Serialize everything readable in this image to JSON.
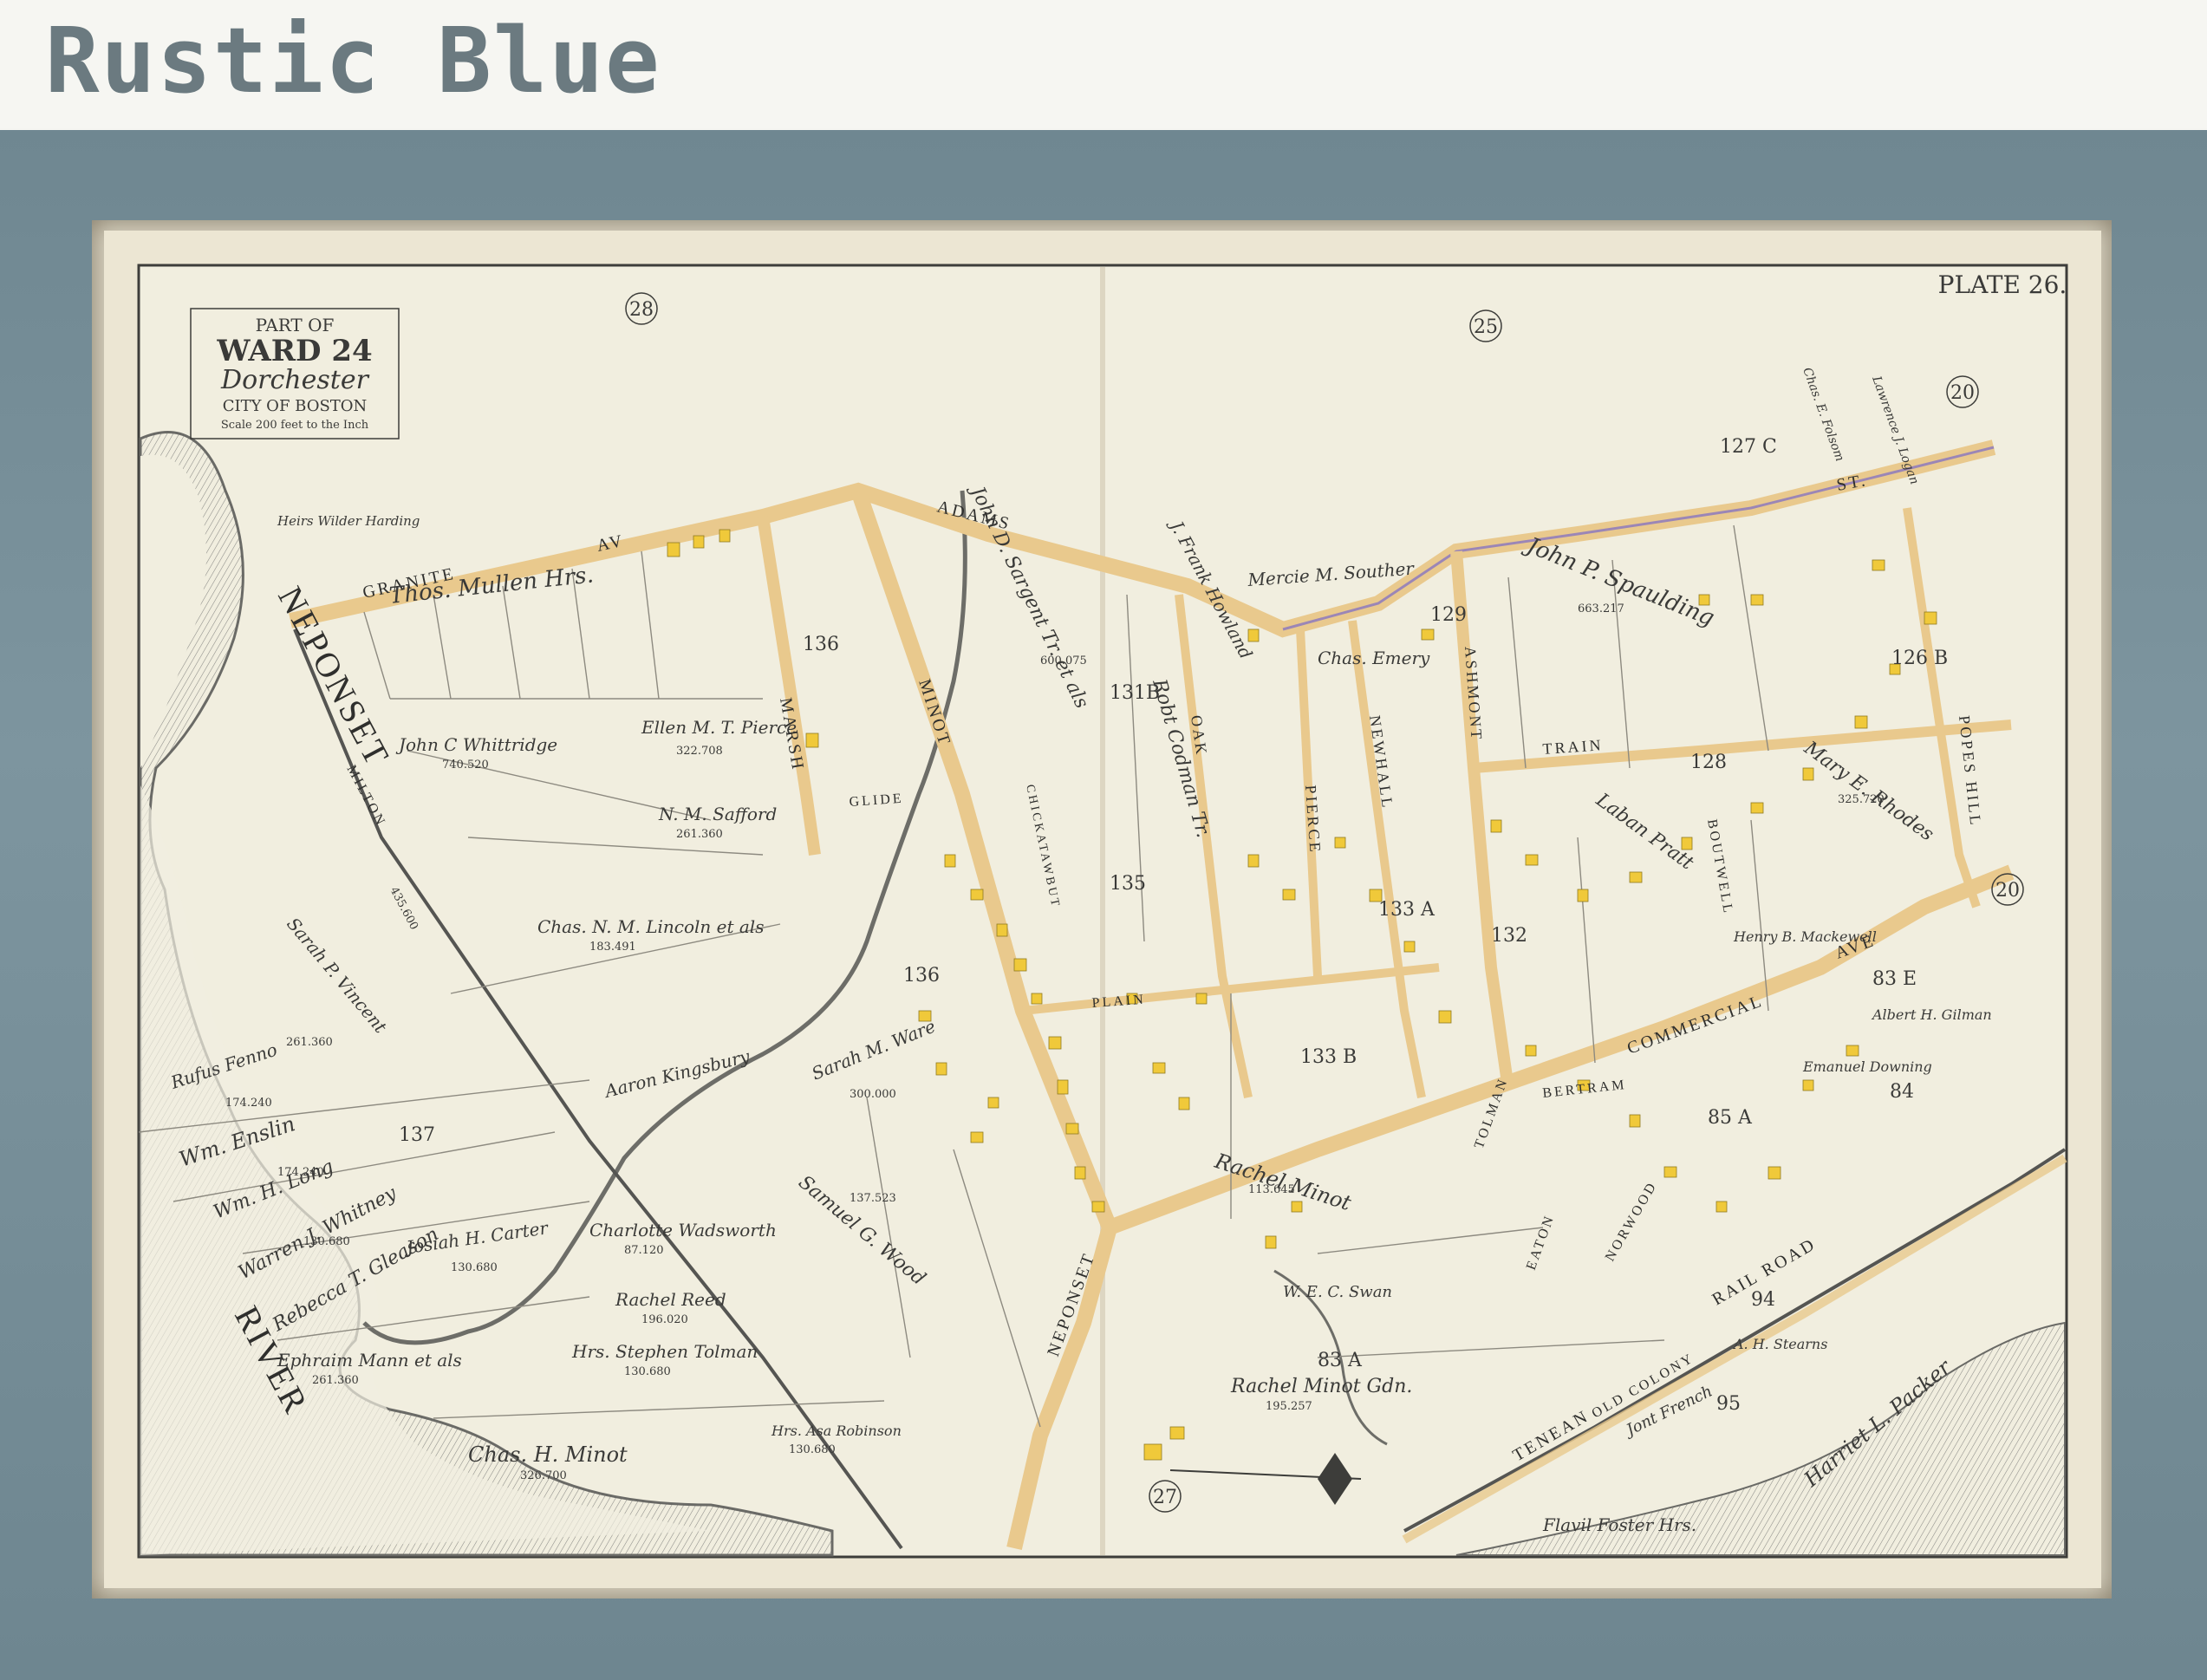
{
  "header": {
    "title": "Rustic Blue"
  },
  "map": {
    "plate": "PLATE 26.",
    "title_box": {
      "line1": "PART OF",
      "line2": "WARD 24",
      "line3": "Dorchester",
      "line4": "CITY OF BOSTON",
      "line5": "Scale 200 feet to the Inch"
    },
    "plate_refs": [
      "28",
      "25",
      "20",
      "20",
      "27"
    ],
    "streets": [
      "GRANITE",
      "AV",
      "ADAMS",
      "ST.",
      "MARSH",
      "MINOT",
      "OAK",
      "PIERCE",
      "NEWHALL",
      "ASHMONT",
      "TRAIN",
      "BOUTWELL",
      "COMMERCIAL",
      "AVE",
      "POPES HILL",
      "NEPONSET",
      "TENEAN",
      "RAIL ROAD",
      "OLD COLONY",
      "MILTON",
      "CHICKATAWBUT",
      "GLIDE",
      "PLAIN",
      "NORWOOD",
      "EATON",
      "TOLMAN",
      "BERTRAM"
    ],
    "river": [
      "NEPONSET",
      "RIVER"
    ],
    "lot_numbers": [
      "136",
      "136",
      "131B",
      "129",
      "127 C",
      "126 B",
      "128",
      "83 E",
      "83 A",
      "84",
      "85 A",
      "94",
      "95",
      "133 A",
      "132",
      "133 B",
      "135",
      "137"
    ],
    "owners": [
      "Thos. Mullen Hrs.",
      "John C Whittridge",
      "Ellen M. T. Pierce",
      "N. M. Safford",
      "Chas. N. M. Lincoln et als",
      "Sarah P. Vincent",
      "Rufus Fenno",
      "Wm. Enslin",
      "Wm. H. Long",
      "Warren J. Whitney",
      "Rebecca T. Gleason",
      "Josiah H. Carter",
      "Ephraim Mann et als",
      "Charlotte Wadsworth",
      "Rachel Reed",
      "Hrs. Stephen Tolman",
      "Chas. H. Minot",
      "Hrs. Asa Robinson",
      "Samuel G. Wood",
      "Sarah M. Ware",
      "Aaron Kingsbury",
      "John D. Sargent Tr. et als",
      "Robt Codman Tr.",
      "J. Frank Howland",
      "Mercie M. Souther",
      "John P. Spaulding",
      "Laban Pratt",
      "Mary E. Rhodes",
      "Chas. Emery",
      "Henry B. Mackewell",
      "Rachel Minot",
      "Rachel Minot Gdn.",
      "W. E. C. Swan",
      "Emanuel Downing",
      "Harriet L. Packer",
      "Flavil Foster Hrs.",
      "A. H. Stearns",
      "Jont French",
      "Lawrence J. Logan",
      "Chas. E. Folsom",
      "Albert H. Gilman",
      "Heirs Wilder Harding"
    ],
    "areas": [
      "740.520",
      "322.708",
      "261.360",
      "435.600",
      "183.491",
      "261.360",
      "174.240",
      "174.240",
      "130.680",
      "130.680",
      "261.360",
      "87.120",
      "196.020",
      "130.680",
      "326.700",
      "130.680",
      "137.523",
      "300.000",
      "600.075",
      "663.217",
      "325.720",
      "113.645",
      "195.257"
    ]
  }
}
